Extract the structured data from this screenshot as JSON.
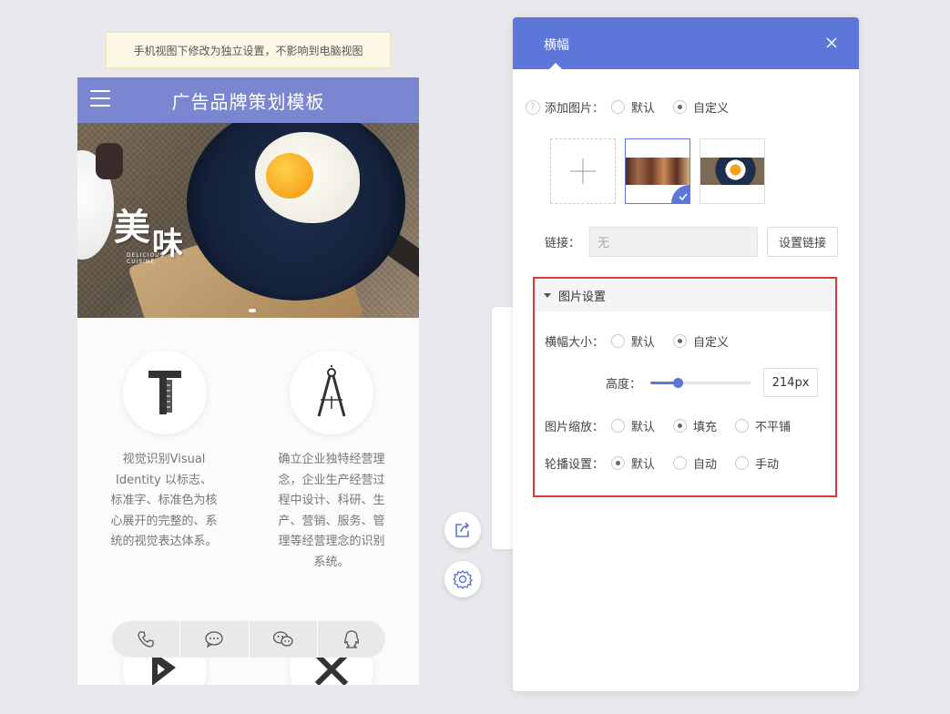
{
  "notice": {
    "text": "手机视图下修改为独立设置，不影响到电脑视图"
  },
  "phone": {
    "title": "广告品牌策划模板",
    "banner": {
      "big_text_1": "美",
      "big_text_2": "味",
      "sub_line_1": "DELICIOUS",
      "sub_line_2": "CUISINE",
      "height_fraction": 0.33
    },
    "features": [
      {
        "icon": "ruler-hammer-icon",
        "text": "视觉识别Visual Identity 以标志、标准字、标准色为核心展开的完整的、系统的视觉表达体系。"
      },
      {
        "icon": "compass-icon",
        "text": "确立企业独特经营理念，企业生产经营过程中设计、科研、生产、营销、服务、管理等经营理念的识别系统。"
      }
    ],
    "bottom_bar": [
      "phone-icon",
      "message-icon",
      "wechat-icon",
      "qq-icon"
    ]
  },
  "float_buttons": [
    "share-icon",
    "settings-icon"
  ],
  "panel": {
    "title": "横幅",
    "add_image": {
      "label": "添加图片：",
      "options": [
        "默认",
        "自定义"
      ],
      "selected": 1
    },
    "thumbnails": [
      {
        "kind": "add",
        "icon": "plus-icon"
      },
      {
        "kind": "image",
        "selected": true,
        "colors": [
          "#6b4a3a",
          "#a36a4a",
          "#d9b48a"
        ]
      },
      {
        "kind": "image",
        "selected": false,
        "colors": [
          "#1c2d4d",
          "#f5a31a",
          "#7a6a55"
        ]
      }
    ],
    "link": {
      "label": "链接：",
      "value": "无",
      "button": "设置链接"
    },
    "image_settings": {
      "title": "图片设置",
      "banner_size": {
        "label": "横幅大小：",
        "options": [
          "默认",
          "自定义"
        ],
        "selected": 1
      },
      "height": {
        "label": "高度：",
        "value": "214px",
        "slider_fraction": 0.27
      },
      "image_scale": {
        "label": "图片缩放：",
        "options": [
          "默认",
          "填充",
          "不平铺"
        ],
        "selected": 1
      },
      "carousel": {
        "label": "轮播设置：",
        "options": [
          "默认",
          "自动",
          "手动"
        ],
        "selected": 0
      }
    }
  },
  "colors": {
    "accent": "#5d76d9",
    "phone_header": "#7b86d1",
    "highlight_border": "#e0393b"
  }
}
